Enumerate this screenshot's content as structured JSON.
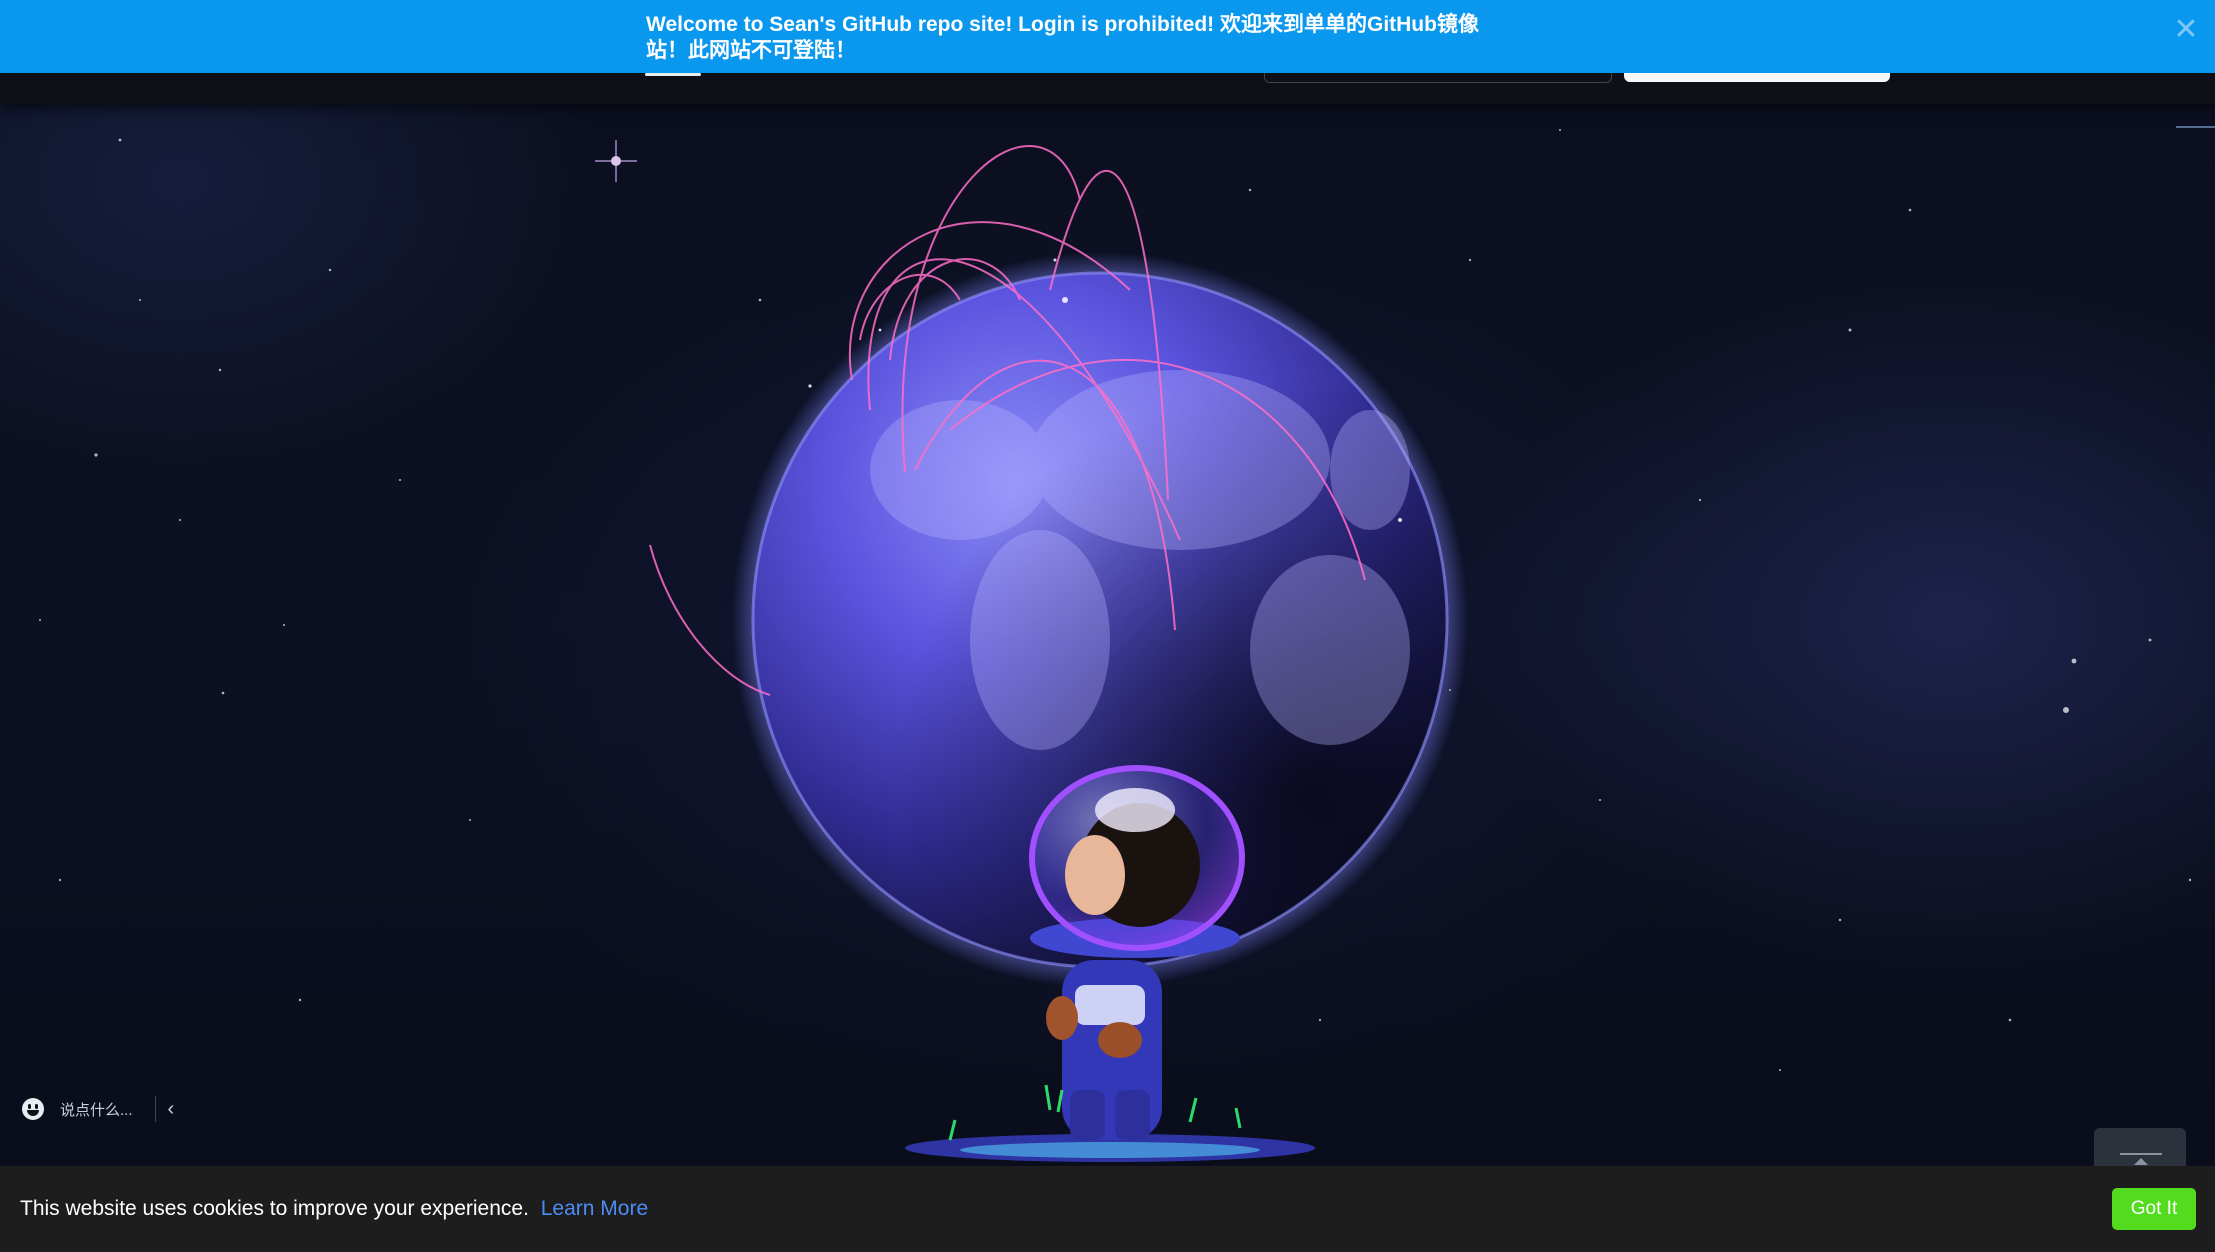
{
  "banner": {
    "message": "Welcome to Sean's GitHub repo site! Login is prohibited! 欢迎来到单单的GitHub镜像站！此网站不可登陆！",
    "close_icon": "close-icon"
  },
  "chat": {
    "placeholder": "说点什么...",
    "icon": "smile-icon",
    "toggle_icon": "chevron-left-icon",
    "toggle_glyph": "‹"
  },
  "back_to_top": {
    "icon": "arrow-up-icon"
  },
  "cookie": {
    "message": "This website uses cookies to improve your experience.",
    "link_label": "Learn More",
    "button_label": "Got It"
  },
  "colors": {
    "banner": "#0a98ef",
    "cookie_button": "#52dc1d",
    "cookie_link": "#4d8bf5",
    "page_bg": "#0d1117"
  }
}
